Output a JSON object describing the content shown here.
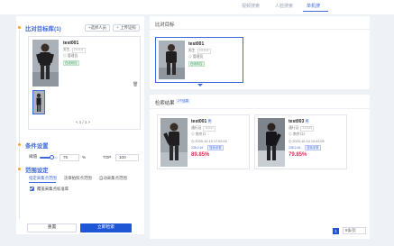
{
  "nav": {
    "tabs": [
      "视频搜索",
      "人脸搜索",
      "单机搜"
    ]
  },
  "left": {
    "compare_title": "比对目标库(1)",
    "btn_select": "+选择人员",
    "btn_upload": "+ 上传证照",
    "person": {
      "name": "test001",
      "gender_label": "男生",
      "badge": "1111111",
      "role": "管理员",
      "tag": "在线布控"
    },
    "pager": "< 1 / 1 >",
    "condition_title": "条件设置",
    "threshold_label": "阈值",
    "threshold_value": "75",
    "percent": "%",
    "top_label": "TOP",
    "top_value": "100",
    "scope_title": "范围设定",
    "scope_tabs": [
      "指定采集点范围",
      "违章拍照点范围",
      "自动采集点范围"
    ],
    "checkbox_label": "覆盖采集点标准库",
    "reset_label": "重置",
    "search_label": "立即检索"
  },
  "right": {
    "compare_title": "比对目标",
    "target": {
      "name": "test001",
      "gender_label": "男生",
      "badge": "1111111",
      "role": "管理员",
      "tag": "在线布控"
    },
    "results_title": "检索结果",
    "results_count": "2个结果",
    "results": [
      {
        "name": "test001",
        "gender": "男",
        "unit_label": "通行证",
        "badge": "111111",
        "loc": "南京口",
        "time": "2020-10-13 17:02:24",
        "ip": "235:2:16",
        "ip_tag": "搜索参数",
        "score": "89.85%"
      },
      {
        "name": "test003",
        "gender": "男",
        "unit_label": "通行证",
        "badge": "333333",
        "loc": "南京口2",
        "time": "2020-10-14 10:42:05",
        "ip": "235:2:16",
        "ip_tag": "搜索参数",
        "score": "79.85%"
      }
    ],
    "page_num": "1",
    "page_size": "8条/页"
  },
  "colors": {
    "accent": "#3f6ad8",
    "primary_btn": "#1e56d6",
    "score": "#e0305a",
    "section_dot": "#f5a623"
  }
}
